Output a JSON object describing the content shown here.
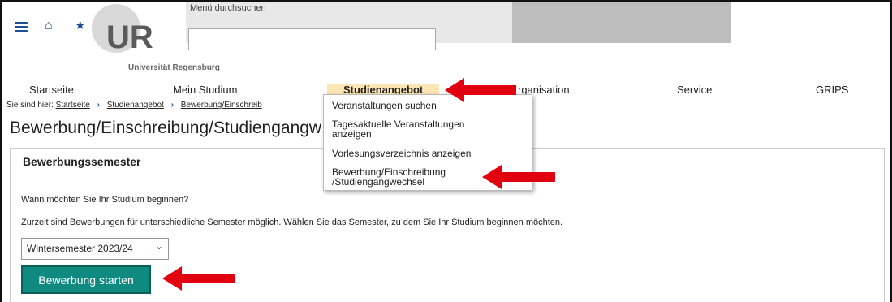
{
  "header": {
    "search_label": "Menü durchsuchen",
    "logo_caption": "Universität Regensburg",
    "logo_letters": "UR"
  },
  "nav": {
    "items": [
      "Startseite",
      "Mein Studium",
      "Studienangebot",
      "Organisation",
      "Service",
      "GRIPS"
    ],
    "active_index": 2,
    "hidden_prefix": "rganisation"
  },
  "breadcrumb": {
    "prefix": "Sie sind hier:",
    "items": [
      "Startseite",
      "Studienangebot",
      "Bewerbung/Einschreib"
    ]
  },
  "page": {
    "title": "Bewerbung/Einschreibung/Studiengangw",
    "section_title": "Bewerbungssemester",
    "question": "Wann möchten Sie Ihr Studium beginnen?",
    "info": "Zurzeit sind Bewerbungen für unterschiedliche Semester möglich. Wählen Sie das Semester, zu dem Sie Ihr Studium beginnen möchten.",
    "semester_select": "Wintersemester 2023/24",
    "start_button": "Bewerbung starten"
  },
  "dropdown": {
    "items": [
      "Veranstaltungen suchen",
      "Tagesaktuelle Veranstaltungen anzeigen",
      "Vorlesungsverzeichnis anzeigen",
      "Bewerbung/Einschreibung /Studiengangwechsel"
    ]
  },
  "colors": {
    "accent": "#1e4e96",
    "button": "#0e8a80",
    "active_nav": "#fde6b3",
    "arrow": "#e0000f"
  },
  "icons": [
    "menu-icon",
    "home-icon",
    "star-icon",
    "chevron-right-icon",
    "chevron-down-icon",
    "arrow-annotation"
  ]
}
